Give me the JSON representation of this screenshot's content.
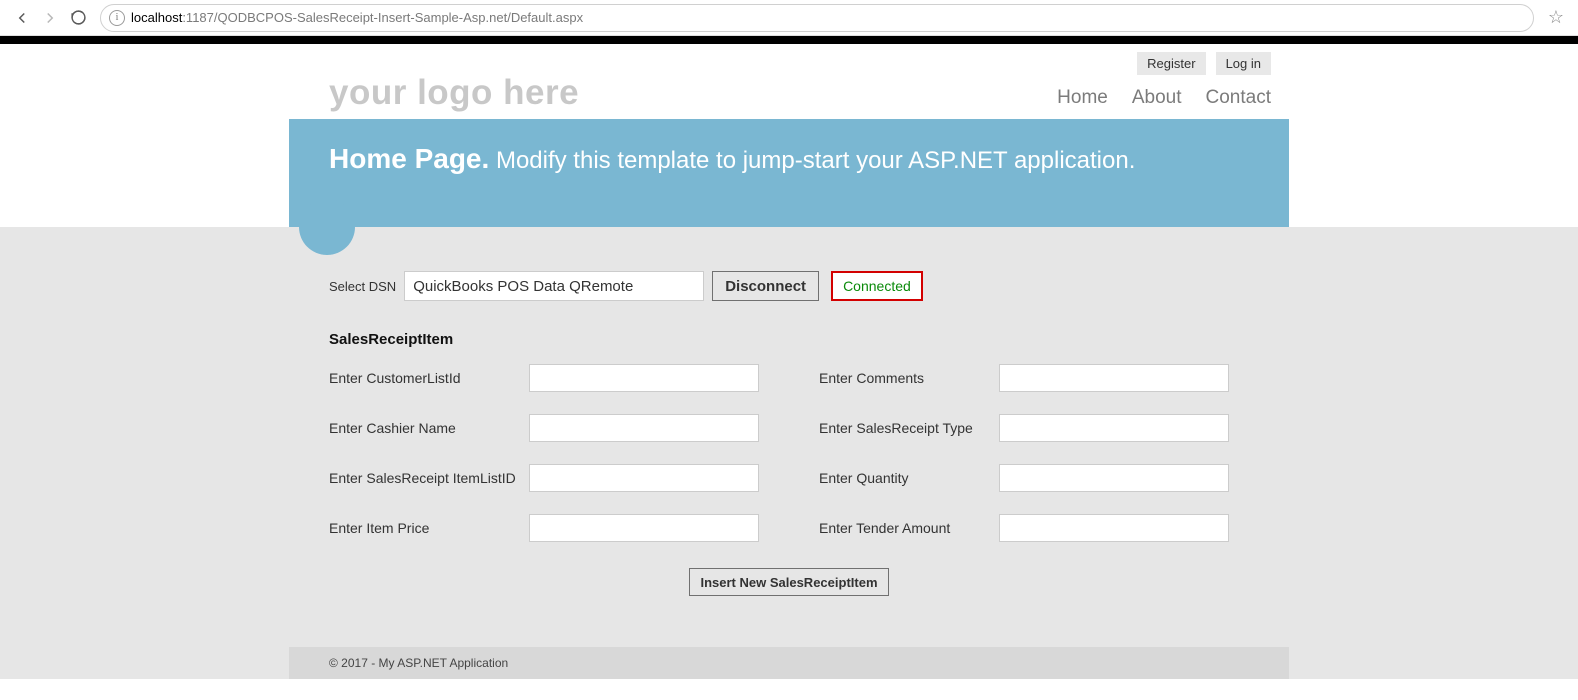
{
  "browser": {
    "url_host": "localhost",
    "url_port_path": ":1187/QODBCPOS-SalesReceipt-Insert-Sample-Asp.net/Default.aspx"
  },
  "account": {
    "register": "Register",
    "login": "Log in"
  },
  "logo_text": "your logo here",
  "nav": {
    "home": "Home",
    "about": "About",
    "contact": "Contact"
  },
  "hero": {
    "title": "Home Page.",
    "subtitle": "Modify this template to jump-start your ASP.NET application."
  },
  "dsn": {
    "label": "Select DSN",
    "value": "QuickBooks POS Data QRemote",
    "button": "Disconnect",
    "status": "Connected"
  },
  "section_title": "SalesReceiptItem",
  "fields": {
    "customer_list_id": {
      "label": "Enter CustomerListId",
      "value": ""
    },
    "comments": {
      "label": "Enter Comments",
      "value": ""
    },
    "cashier_name": {
      "label": "Enter Cashier Name",
      "value": ""
    },
    "salesreceipt_type": {
      "label": "Enter SalesReceipt Type",
      "value": ""
    },
    "salesreceipt_itemlistid": {
      "label": "Enter SalesReceipt ItemListID",
      "value": ""
    },
    "quantity": {
      "label": "Enter Quantity",
      "value": ""
    },
    "item_price": {
      "label": "Enter Item Price",
      "value": ""
    },
    "tender_amount": {
      "label": "Enter Tender Amount",
      "value": ""
    }
  },
  "submit_label": "Insert New SalesReceiptItem",
  "footer": "© 2017 - My ASP.NET Application"
}
